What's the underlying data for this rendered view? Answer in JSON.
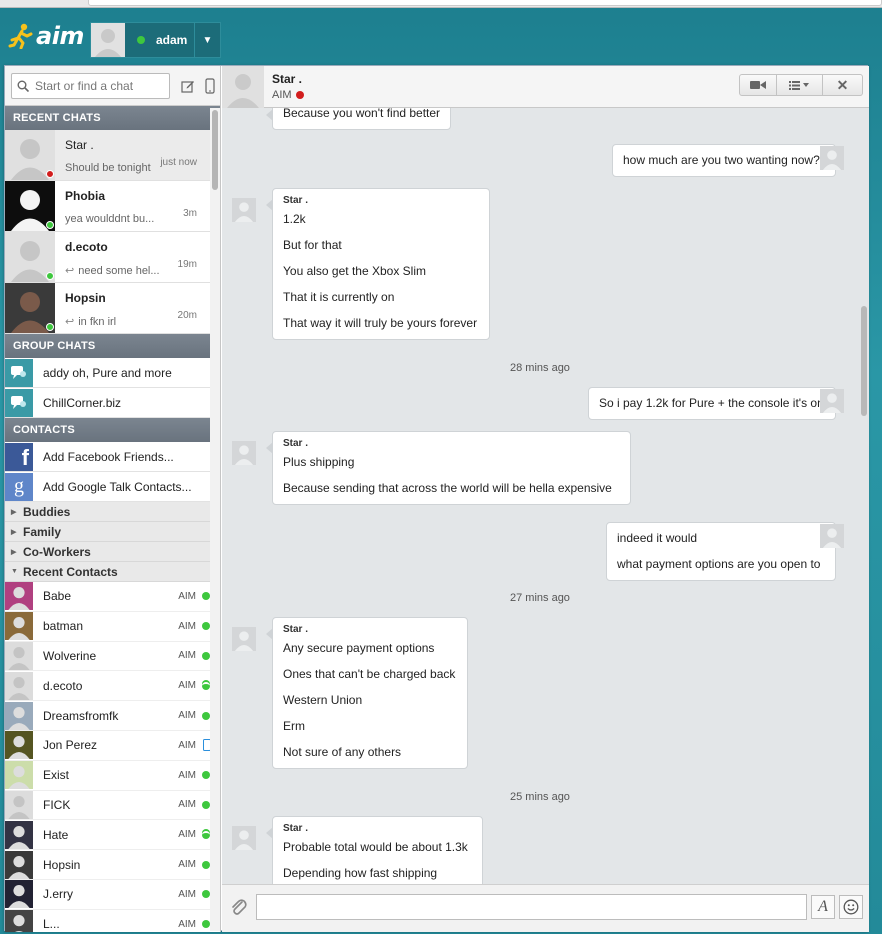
{
  "app": {
    "logo_text": "aim"
  },
  "user": {
    "name": "adam"
  },
  "search": {
    "placeholder": "Start or find a chat"
  },
  "sections": {
    "recent": "RECENT CHATS",
    "groups": "GROUP CHATS",
    "contacts": "CONTACTS"
  },
  "recent_chats": [
    {
      "name": "Star .",
      "preview": "Should be tonight",
      "time": "just now",
      "status": "red",
      "bold": false
    },
    {
      "name": "Phobia",
      "preview": "yea woulddnt bu...",
      "time": "3m",
      "status": "green",
      "bold": true
    },
    {
      "name": "d.ecoto",
      "preview": "need some hel...",
      "time": "19m",
      "status": "green",
      "bold": true
    },
    {
      "name": "Hopsin",
      "preview": "in fkn irl",
      "time": "20m",
      "status": "green",
      "bold": true
    }
  ],
  "group_chats": [
    {
      "name": "addy oh, Pure and more"
    },
    {
      "name": "ChillCorner.biz"
    }
  ],
  "contact_actions": [
    {
      "label": "Add Facebook Friends..."
    },
    {
      "label": "Add Google Talk Contacts..."
    }
  ],
  "folders": [
    {
      "label": "Buddies",
      "expanded": false
    },
    {
      "label": "Family",
      "expanded": false
    },
    {
      "label": "Co-Workers",
      "expanded": false
    },
    {
      "label": "Recent Contacts",
      "expanded": true
    }
  ],
  "contacts": [
    {
      "name": "Babe",
      "net": "AIM",
      "status": "green"
    },
    {
      "name": "batman",
      "net": "AIM",
      "status": "green"
    },
    {
      "name": "Wolverine",
      "net": "AIM",
      "status": "green"
    },
    {
      "name": "d.ecoto",
      "net": "AIM",
      "status": "green-away"
    },
    {
      "name": "Dreamsfromfk",
      "net": "AIM",
      "status": "green"
    },
    {
      "name": "Jon Perez",
      "net": "AIM",
      "status": "mobile"
    },
    {
      "name": "Exist",
      "net": "AIM",
      "status": "green"
    },
    {
      "name": "FICK",
      "net": "AIM",
      "status": "green"
    },
    {
      "name": "Hate",
      "net": "AIM",
      "status": "green-away"
    },
    {
      "name": "Hopsin",
      "net": "AIM",
      "status": "green"
    },
    {
      "name": "J.erry",
      "net": "AIM",
      "status": "green"
    },
    {
      "name": "L...",
      "net": "AIM",
      "status": "green"
    }
  ],
  "chat": {
    "name": "Star .",
    "network": "AIM",
    "messages": [
      {
        "dir": "in",
        "sender": "",
        "lines": [
          "Because you won't find better"
        ]
      },
      {
        "dir": "out",
        "lines": [
          "how much are you two wanting now?"
        ]
      },
      {
        "dir": "in",
        "sender": "Star .",
        "lines": [
          "1.2k",
          "But for that",
          "You also get the Xbox Slim",
          "That it is currently on",
          "That way it will truly be yours forever"
        ]
      },
      {
        "dir": "time",
        "text": "28 mins ago"
      },
      {
        "dir": "out",
        "lines": [
          "So i pay 1.2k for Pure + the console it's on"
        ]
      },
      {
        "dir": "in",
        "sender": "Star .",
        "lines": [
          "Plus shipping",
          "Because sending that across the world will be hella expensive"
        ]
      },
      {
        "dir": "out",
        "lines": [
          "indeed it would",
          "what payment options are you open to"
        ]
      },
      {
        "dir": "time",
        "text": "27 mins ago"
      },
      {
        "dir": "in",
        "sender": "Star .",
        "lines": [
          "Any secure payment options",
          "Ones that can't be charged back",
          "Western Union",
          "Erm",
          "Not sure of any others"
        ]
      },
      {
        "dir": "time",
        "text": "25 mins ago"
      },
      {
        "dir": "in",
        "sender": "Star .",
        "lines": [
          "Probable total would be about 1.3k",
          "Depending how fast shipping"
        ]
      }
    ]
  },
  "colors": {
    "online": "#3ec73e",
    "offline": "#d21d1d",
    "accent": "#1c6c79",
    "mobile": "#2b8fdc"
  }
}
